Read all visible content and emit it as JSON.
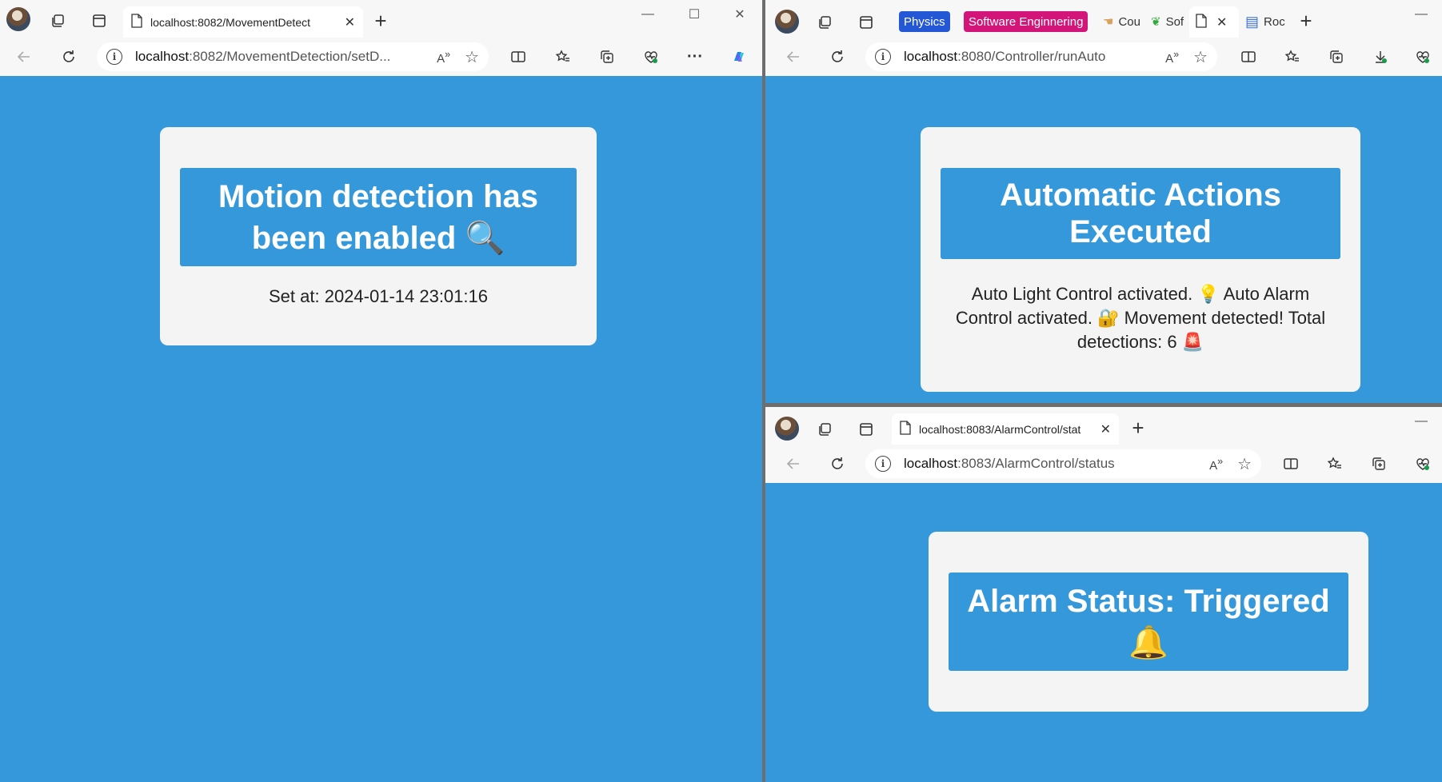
{
  "left": {
    "tab_title": "localhost:8082/MovementDetect",
    "url_host": "localhost",
    "url_rest": ":8082/MovementDetection/setD...",
    "read_aloud": "Â⁾",
    "banner": "Motion detection has been enabled 🔍",
    "set_at": "Set at: 2024-01-14 23:01:16"
  },
  "top_right": {
    "chips": [
      "Physics",
      "Software Enginnering"
    ],
    "mini_tabs": [
      "Cou",
      "Sof",
      "Roc"
    ],
    "url_host": "localhost",
    "url_rest": ":8080/Controller/runAuto",
    "banner": "Automatic Actions Executed",
    "message": "Auto Light Control activated. 💡 Auto Alarm Control activated. 🔐 Movement detected! Total detections: 6 🚨",
    "chip_colors": [
      "#2457d6",
      "#d3157a"
    ]
  },
  "bottom_right": {
    "tab_title": "localhost:8083/AlarmControl/stat",
    "url_host": "localhost",
    "url_rest": ":8083/AlarmControl/status",
    "banner": "Alarm Status: Triggered 🔔"
  },
  "colors": {
    "page_bg": "#3498db",
    "card_bg": "#f4f4f4",
    "banner_bg": "#3498db"
  }
}
